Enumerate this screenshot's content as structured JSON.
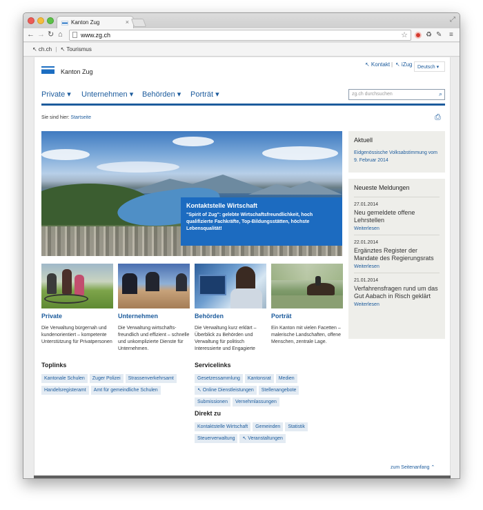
{
  "browser": {
    "tab_title": "Kanton Zug",
    "tab_close": "×",
    "url": "www.zg.ch"
  },
  "bookmarks": [
    {
      "label": "↖ ch.ch"
    },
    {
      "label": "↖ Tourismus"
    }
  ],
  "bookmark_separator": "|",
  "site": {
    "logo_text": "Kanton Zug",
    "util_kontakt": "↖ Kontakt",
    "util_separator": "|",
    "util_izug": "↖ iZug",
    "language": "Deutsch ▾"
  },
  "nav": {
    "items": [
      {
        "label": "Private ▾"
      },
      {
        "label": "Unternehmen ▾"
      },
      {
        "label": "Behörden ▾"
      },
      {
        "label": "Porträt ▾"
      }
    ],
    "search_placeholder": "zg.ch durchsuchen"
  },
  "breadcrumb": {
    "prefix": "Sie sind hier:",
    "link": "Startseite"
  },
  "hero": {
    "title": "Kontaktstelle Wirtschaft",
    "text": "\"Spirit of Zug\": gelebte Wirtschaftsfreundlichkeit, hoch qualifizierte Fachkräfte, Top-Bildungsstätten, höchste Lebensqualität!"
  },
  "teasers": [
    {
      "title": "Private",
      "text": "Die Verwaltung bürgernah und kundenorientiert – kompetente Unterstützung für Privatpersonen"
    },
    {
      "title": "Unternehmen",
      "text": "Die Verwaltung wirtschafts-freundlich und effizient – schnelle und unkomplizierte Dienste für Unternehmen."
    },
    {
      "title": "Behörden",
      "text": "Die Verwaltung kurz erklärt – Überblick zu Behörden und Verwaltung für politisch Interessierte und Engagierte"
    },
    {
      "title": "Porträt",
      "text": "Ein Kanton mit vielen Facetten – malerische Landschaften, offene Menschen, zentrale Lage."
    }
  ],
  "toplinks": {
    "heading": "Toplinks",
    "tags": [
      "Kantonale Schulen",
      "Zuger Polizei",
      "Strassenverkehrsamt",
      "Handelsregisteramt",
      "Amt für gemeindliche Schulen"
    ]
  },
  "servicelinks": {
    "heading": "Servicelinks",
    "tags": [
      "Gesetzessammlung",
      "Kantonsrat",
      "Medien",
      "↖ Online Dienstleistungen",
      "Stellenangebote",
      "Submissionen",
      "Vernehmlassungen"
    ]
  },
  "direktzu": {
    "heading": "Direkt zu",
    "tags": [
      "Kontaktstelle Wirtschaft",
      "Gemeinden",
      "Statistik",
      "Steuerverwaltung",
      "↖ Veranstaltungen"
    ]
  },
  "aktuell": {
    "heading": "Aktuell",
    "link": "Eidgenössische Volksabstimmung vom 9. Februar 2014"
  },
  "news": {
    "heading": "Neueste Meldungen",
    "items": [
      {
        "date": "27.01.2014",
        "title": "Neu gemeldete offene Lehrstellen",
        "more": "Weiterlesen"
      },
      {
        "date": "22.01.2014",
        "title": "Ergänztes Register der Mandate des Regierungsrats",
        "more": "Weiterlesen"
      },
      {
        "date": "21.01.2014",
        "title": "Verfahrensfragen rund um das Gut Aabach in Risch geklärt",
        "more": "Weiterlesen"
      }
    ]
  },
  "footer": {
    "totop": "zum Seitenanfang ⌃"
  }
}
